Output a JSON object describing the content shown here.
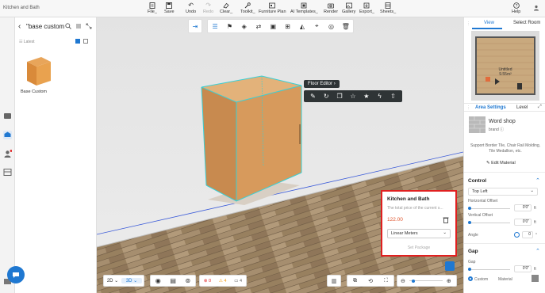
{
  "app": {
    "title": "Kitchen and Bath"
  },
  "toolbar": {
    "file": "File_",
    "save": "Save",
    "undo": "Undo",
    "redo": "Redo",
    "clear": "Clear_",
    "toolkit": "Toolkit_",
    "furniture_plan": "Furniture Plan",
    "ai_templates": "AI Templates_",
    "render": "Render",
    "gallery": "Gallery",
    "export": "Export_",
    "sheets": "Sheets_",
    "help": "Help"
  },
  "catalog": {
    "title": "\"base custom",
    "latest": "Latest",
    "product_name": "Base Custom"
  },
  "floor_editor": {
    "label": "Floor Editor"
  },
  "kitchen_popup": {
    "title": "Kitchen and Bath",
    "description": "The total price of the current s...",
    "price": "122.00",
    "unit_select": "Linear Meters",
    "set_package": "Set Package"
  },
  "bottom": {
    "mode_2d": "2D",
    "mode_3d": "3D",
    "count_red": "0",
    "count_orange": "4",
    "count_grey": "4"
  },
  "right_panel": {
    "tab_view": "View",
    "tab_select_room": "Select Room",
    "minimap_room_label": "Untitled",
    "minimap_room_area": "9.55m²",
    "tab_area_settings": "Area Settings",
    "tab_level": "Level",
    "material_name": "Word shop",
    "material_brand": "brand ⓘ",
    "material_desc": "Support Border Tile, Chair Rail Molding, Tile Medallion, etc.",
    "edit_material": "Edit Material",
    "control_title": "Control",
    "control_select": "Top Left",
    "h_offset_label": "Horizontal Offset",
    "h_offset_value": "0'0\"",
    "h_offset_unit": "ft",
    "v_offset_label": "Vertical Offset",
    "v_offset_value": "0'0\"",
    "v_offset_unit": "ft",
    "angle_label": "Angle",
    "angle_value": "0",
    "angle_unit": "°",
    "gap_title": "Gap",
    "gap_label": "Gap",
    "gap_value": "0'0\"",
    "gap_unit": "ft",
    "custom_label": "Custom",
    "material_label": "Material"
  }
}
